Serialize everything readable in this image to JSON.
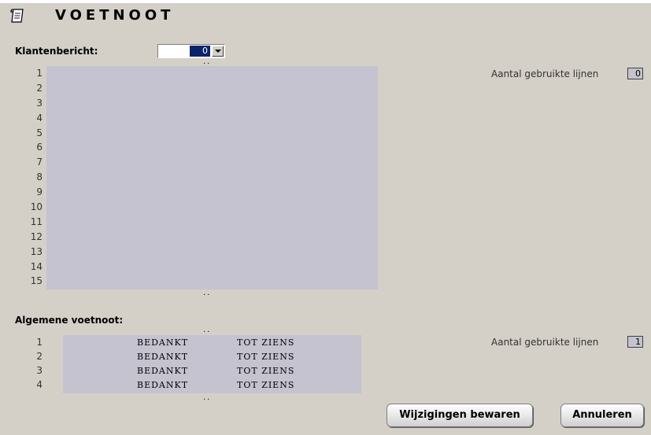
{
  "header": {
    "title": "VOETNOOT",
    "icon": "scroll-icon"
  },
  "klanten": {
    "label": "Klantenbericht:",
    "select_value": "0",
    "dots": "..",
    "line_numbers": [
      "1",
      "2",
      "3",
      "4",
      "5",
      "6",
      "7",
      "8",
      "9",
      "10",
      "11",
      "12",
      "13",
      "14",
      "15"
    ],
    "used_lines_label": "Aantal gebruikte lijnen",
    "used_lines_value": "0"
  },
  "algemene": {
    "label": "Algemene voetnoot:",
    "dots": "..",
    "line_numbers": [
      "1",
      "2",
      "3",
      "4"
    ],
    "rows": [
      {
        "left": "BEDANKT",
        "right": "TOT ZIENS"
      },
      {
        "left": "BEDANKT",
        "right": "TOT ZIENS"
      },
      {
        "left": "BEDANKT",
        "right": "TOT ZIENS"
      },
      {
        "left": "BEDANKT",
        "right": "TOT ZIENS"
      }
    ],
    "used_lines_label": "Aantal gebruikte lijnen",
    "used_lines_value": "1"
  },
  "buttons": {
    "save": "Wijzigingen bewaren",
    "cancel": "Annuleren"
  }
}
